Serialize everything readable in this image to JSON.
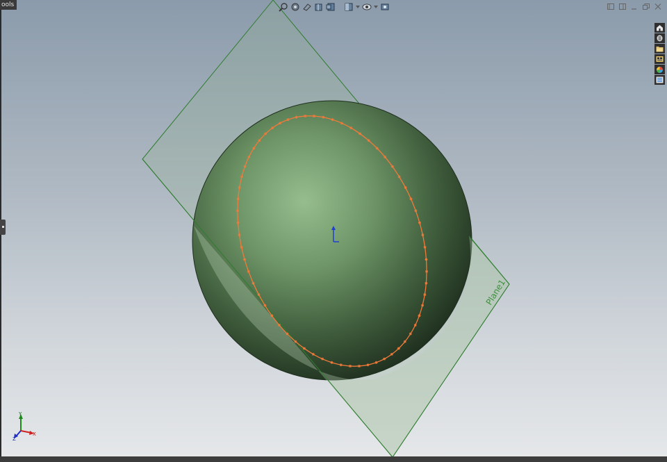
{
  "app": {
    "menu_tab_label": "ools"
  },
  "heads_up_toolbar": {
    "icons": [
      "zoom-to-fit-icon",
      "zoom-area-icon",
      "previous-view-icon",
      "section-view-icon",
      "dynamic-annotation-icon",
      "view-orientation-icon",
      "display-style-icon",
      "hide-show-items-icon",
      "edit-appearance-icon",
      "apply-scene-icon",
      "view-settings-icon"
    ]
  },
  "window_controls": {
    "icons": [
      "tile-horizontal-icon",
      "tile-vertical-icon",
      "minimize-icon",
      "restore-icon",
      "close-icon"
    ]
  },
  "task_pane": {
    "icons": [
      "home-icon",
      "design-library-icon",
      "file-explorer-icon",
      "view-palette-icon",
      "appearances-icon",
      "custom-properties-icon"
    ]
  },
  "scene": {
    "plane_label": "Plane1",
    "colors": {
      "sphere": "#6f9668",
      "plane_fill": "#8fb08a",
      "plane_edge": "#2f7d2f",
      "sketch_curve": "#f07a3a",
      "background_top": "#8b9bab",
      "background_bottom": "#e6e8ea"
    }
  },
  "triad": {
    "x_label": "X",
    "y_label": "Y",
    "z_label": "Z"
  }
}
